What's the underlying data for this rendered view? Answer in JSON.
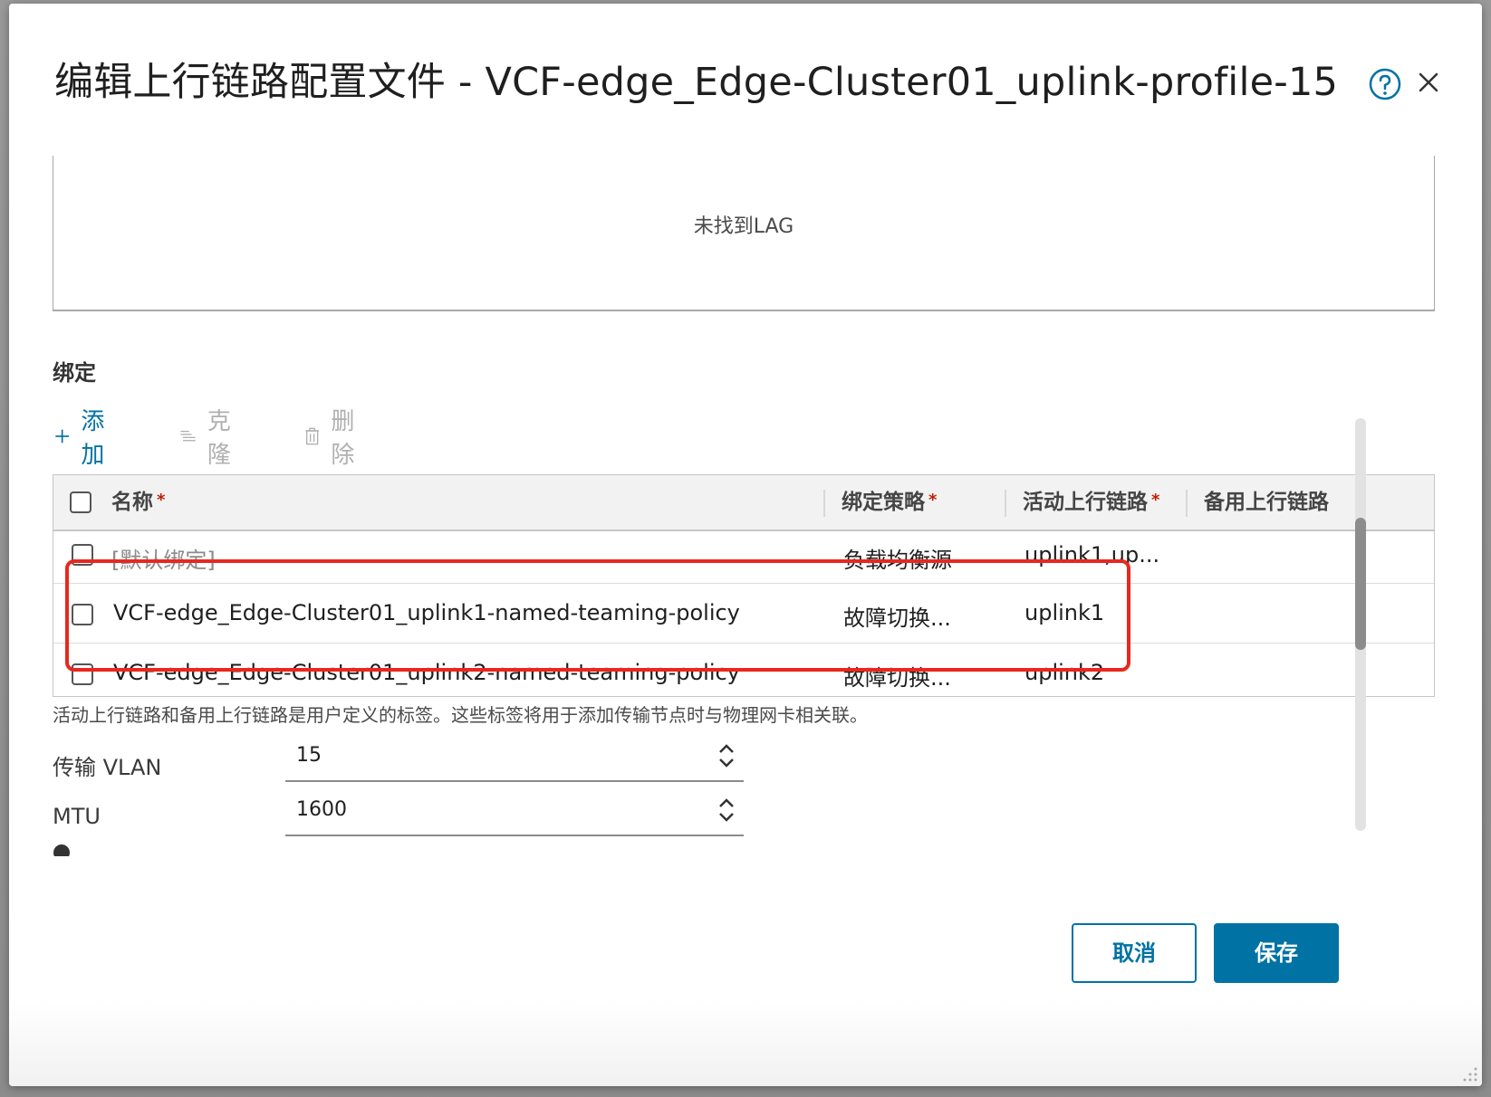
{
  "dialog": {
    "title": "编辑上行链路配置文件 - VCF-edge_Edge-Cluster01_uplink-profile-15",
    "help_icon": "help-circle-icon",
    "close_icon": "close-icon"
  },
  "lag": {
    "empty_text": "未找到LAG"
  },
  "teaming": {
    "section_title": "绑定",
    "toolbar": {
      "add_label": "添加",
      "clone_label": "克隆",
      "delete_label": "删除"
    },
    "columns": {
      "name": "名称",
      "policy": "绑定策略",
      "active": "活动上行链路",
      "standby": "备用上行链路",
      "required_mark": "*"
    },
    "rows": [
      {
        "name": "[默认绑定]",
        "policy": "负载均衡源",
        "active": "uplink1,up...",
        "standby": ""
      },
      {
        "name": "VCF-edge_Edge-Cluster01_uplink1-named-teaming-policy",
        "policy": "故障切换...",
        "active": "uplink1",
        "standby": ""
      },
      {
        "name": "VCF-edge_Edge-Cluster01_uplink2-named-teaming-policy",
        "policy": "故障切换...",
        "active": "uplink2",
        "standby": ""
      }
    ],
    "footnote": "活动上行链路和备用上行链路是用户定义的标签。这些标签将用于添加传输节点时与物理网卡相关联。"
  },
  "form": {
    "transport_vlan_label": "传输 VLAN",
    "transport_vlan_value": "15",
    "mtu_label": "MTU",
    "mtu_value": "1600"
  },
  "buttons": {
    "cancel": "取消",
    "save": "保存"
  },
  "colors": {
    "accent": "#0072a3",
    "highlight": "#e8281e",
    "required": "#c21d00"
  }
}
